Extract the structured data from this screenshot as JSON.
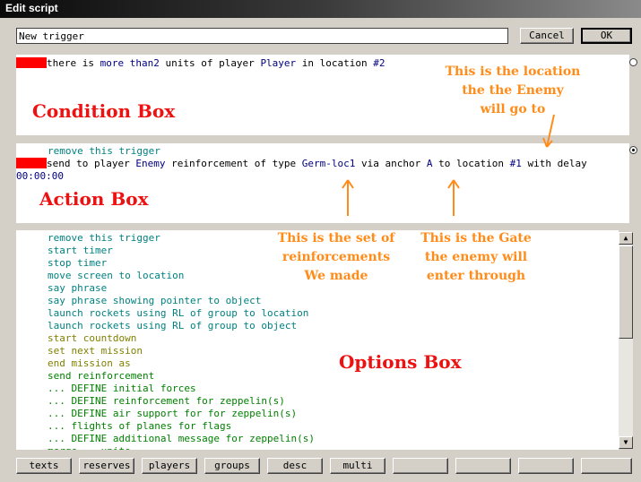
{
  "window": {
    "title": "Edit script"
  },
  "trigger": {
    "name": "New trigger"
  },
  "buttons": {
    "cancel": "Cancel",
    "ok": "OK"
  },
  "condition": {
    "text": [
      {
        "t": "there is ",
        "c": "k"
      },
      {
        "t": "more than",
        "c": "b"
      },
      {
        "t": "2",
        "c": "b"
      },
      {
        "t": " units of player ",
        "c": "k"
      },
      {
        "t": "Player",
        "c": "b"
      },
      {
        "t": " in location ",
        "c": "k"
      },
      {
        "t": "#2",
        "c": "b"
      }
    ]
  },
  "action": {
    "line1": "remove this trigger",
    "line2": [
      {
        "t": "send to player ",
        "c": "k"
      },
      {
        "t": "Enemy",
        "c": "b"
      },
      {
        "t": " reinforcement of type ",
        "c": "k"
      },
      {
        "t": "Germ-loc1",
        "c": "b"
      },
      {
        "t": " via anchor ",
        "c": "k"
      },
      {
        "t": "A",
        "c": "b"
      },
      {
        "t": " to location ",
        "c": "k"
      },
      {
        "t": "#1",
        "c": "b"
      },
      {
        "t": " with delay",
        "c": "k"
      }
    ],
    "line3": "00:00:00"
  },
  "options": [
    {
      "text": "remove this trigger",
      "c": "t"
    },
    {
      "text": "start timer",
      "c": "t"
    },
    {
      "text": "stop timer",
      "c": "t"
    },
    {
      "text": "move screen to location",
      "c": "t"
    },
    {
      "text": "say phrase",
      "c": "t"
    },
    {
      "text": "say phrase showing pointer to object",
      "c": "t"
    },
    {
      "text": "launch rockets using RL of group to location",
      "c": "t"
    },
    {
      "text": "launch rockets using RL of group to object",
      "c": "t"
    },
    {
      "text": "start countdown",
      "c": "o"
    },
    {
      "text": "set next mission",
      "c": "o"
    },
    {
      "text": "end mission as",
      "c": "o"
    },
    {
      "text": "send reinforcement",
      "c": "g"
    },
    {
      "text": "... DEFINE initial forces",
      "c": "g"
    },
    {
      "text": "... DEFINE reinforcement for zeppelin(s)",
      "c": "g"
    },
    {
      "text": "... DEFINE air support for for zeppelin(s)",
      "c": "g"
    },
    {
      "text": "... flights of planes for flags",
      "c": "g"
    },
    {
      "text": "... DEFINE additional message for zeppelin(s)",
      "c": "g"
    },
    {
      "text": "merge... units",
      "c": "g"
    }
  ],
  "annotations": {
    "condition_box": "Condition Box",
    "action_box": "Action Box",
    "options_box": "Options Box",
    "location_note": [
      "This is the location",
      "the the Enemy",
      "will go to"
    ],
    "reinforcement_note": [
      "This is the set of",
      "reinforcements",
      "We made"
    ],
    "gate_note": [
      "This is the Gate",
      "the enemy will",
      "enter through"
    ]
  },
  "bottom_tabs": [
    "texts",
    "reserves",
    "players",
    "groups",
    "desc",
    "multi",
    "",
    "",
    "",
    ""
  ],
  "colors": {
    "annotation_orange": "#ff8c1a",
    "annotation_red": "#ee1111",
    "script_navy": "#000080",
    "script_teal": "#008080",
    "script_green": "#008000",
    "script_olive": "#808000"
  }
}
